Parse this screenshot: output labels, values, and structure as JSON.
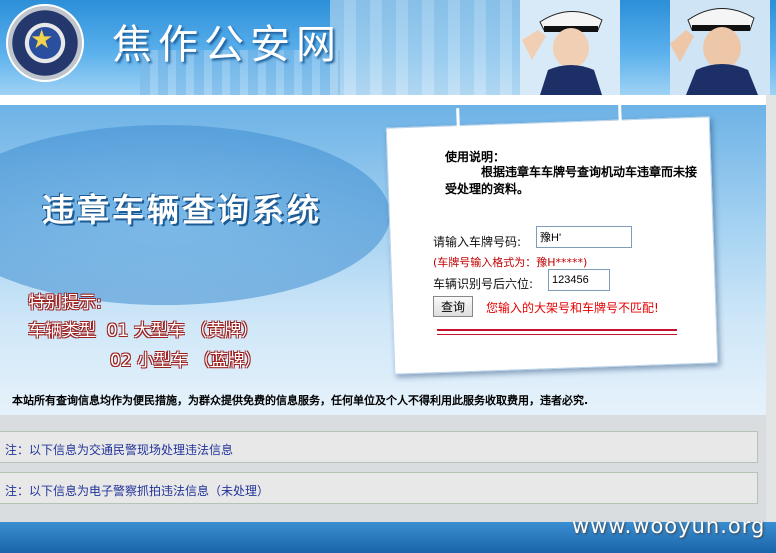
{
  "header": {
    "site_title": "焦作公安网",
    "badge_star": "★"
  },
  "main": {
    "system_title": "违章车辆查询系统",
    "special_title": "特别提示:",
    "vehicle_line1": "车辆类型  01 大型车 （黄牌）",
    "vehicle_line2": "02 小型车 （蓝牌）"
  },
  "query_card": {
    "usage_title": "使用说明：",
    "usage_text": "根据违章车车牌号查询机动车违章而未接受处理的资料。",
    "plate_label": "请输入车牌号码:",
    "plate_value": "豫H'",
    "plate_hint": "(车牌号输入格式为：豫H*****)",
    "vin_label": "车辆识别号后六位:",
    "vin_value": "123456",
    "query_button": "查询",
    "error_message": "您输入的大架号和车牌号不匹配!"
  },
  "notice": "本站所有查询信息均作为便民措施，为群众提供免费的信息服务，任何单位及个人不得利用此服务收取费用，违者必究.",
  "info_boxes": [
    "注：以下信息为交通民警现场处理违法信息",
    "注：以下信息为电子警察抓拍违法信息（未处理）"
  ],
  "watermark": "www.wooyun.org",
  "colors": {
    "header_blue": "#2c8fd8",
    "error_red": "#e60000",
    "hint_red": "#c00000",
    "info_text": "#223399"
  }
}
